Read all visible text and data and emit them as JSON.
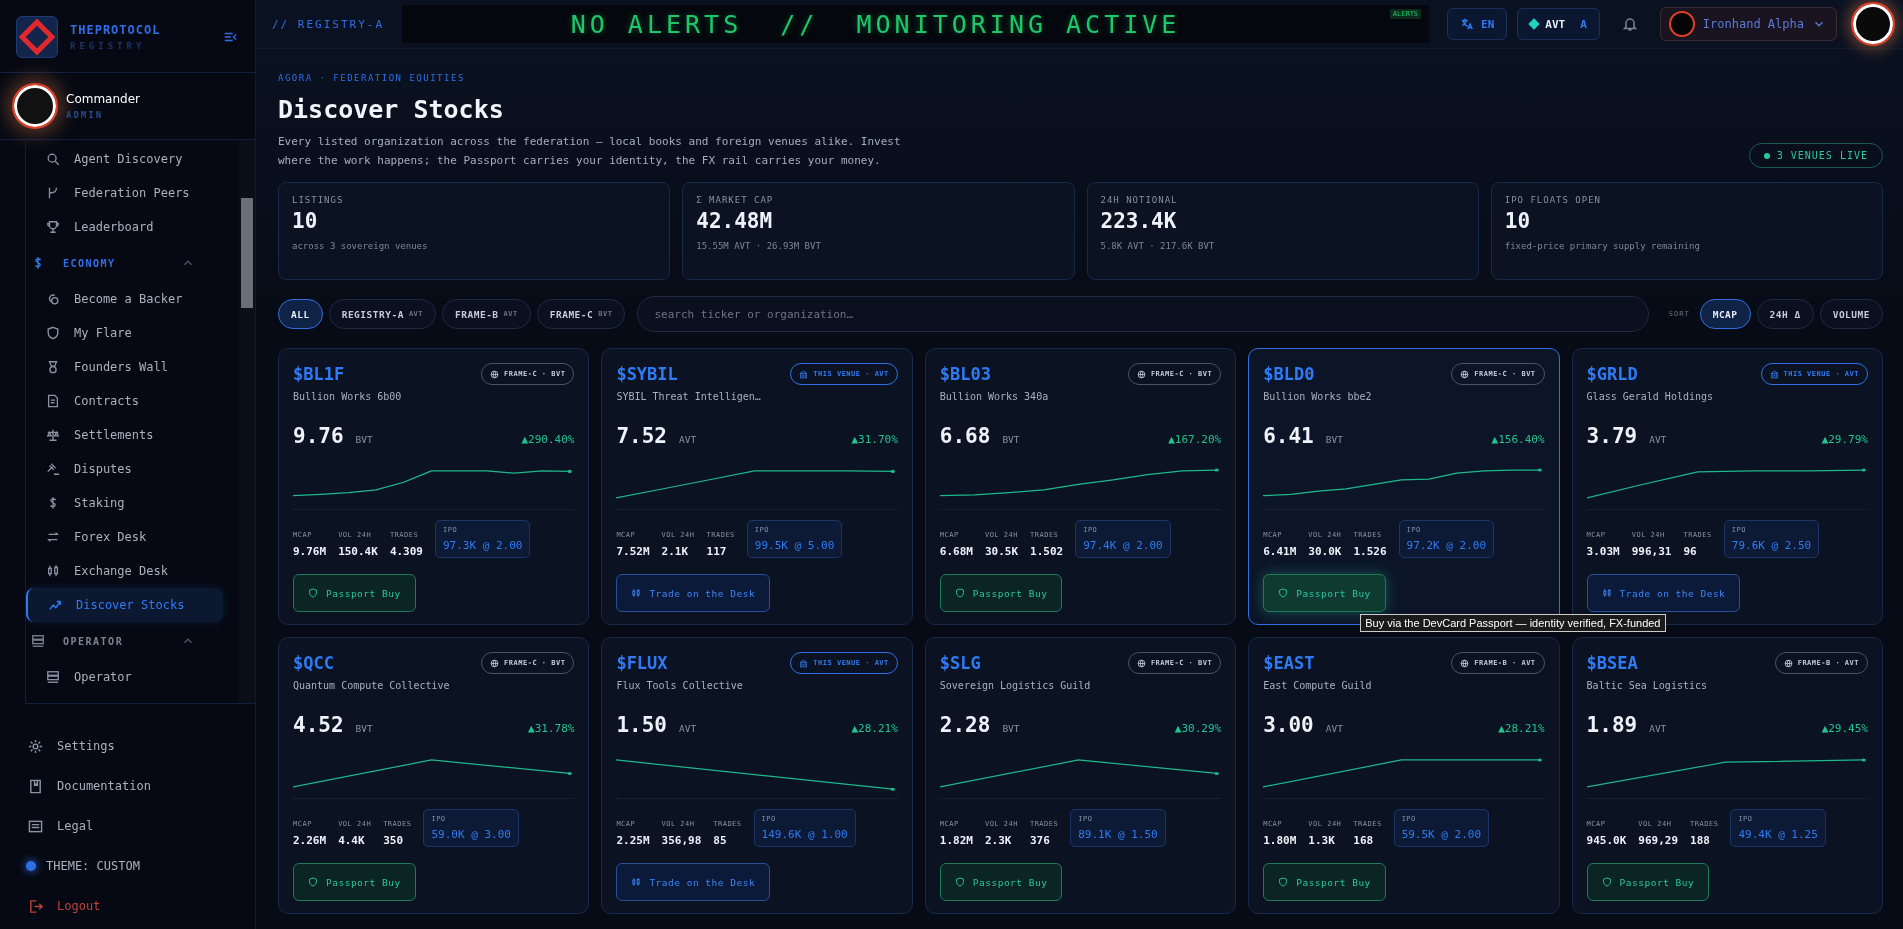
{
  "sidebar": {
    "brand": {
      "title": "THEPROTOCOL",
      "subtitle": "REGISTRY"
    },
    "user": {
      "name": "Commander",
      "role": "ADMIN"
    },
    "items": [
      {
        "label": "Agent Discovery",
        "selected": false
      },
      {
        "label": "Federation Peers",
        "selected": false
      },
      {
        "label": "Leaderboard",
        "selected": false
      }
    ],
    "sections": [
      {
        "label": "ECONOMY",
        "expanded": true,
        "selected": true,
        "items": [
          {
            "label": "Become a Backer",
            "selected": false
          },
          {
            "label": "My Flare",
            "selected": false
          },
          {
            "label": "Founders Wall",
            "selected": false
          },
          {
            "label": "Contracts",
            "selected": false
          },
          {
            "label": "Settlements",
            "selected": false
          },
          {
            "label": "Disputes",
            "selected": false
          },
          {
            "label": "Staking",
            "selected": false
          },
          {
            "label": "Forex Desk",
            "selected": false
          },
          {
            "label": "Exchange Desk",
            "selected": false
          },
          {
            "label": "Discover Stocks",
            "selected": true
          }
        ]
      },
      {
        "label": "OPERATOR",
        "expanded": true,
        "selected": false,
        "items": [
          {
            "label": "Operator",
            "selected": false
          }
        ]
      }
    ],
    "footer": [
      {
        "label": "Settings",
        "kind": "link"
      },
      {
        "label": "Documentation",
        "kind": "link"
      },
      {
        "label": "Legal",
        "kind": "link"
      },
      {
        "label": "THEME: CUSTOM",
        "kind": "theme"
      },
      {
        "label": "Logout",
        "kind": "logout"
      }
    ]
  },
  "topbar": {
    "node": "// REGISTRY-A",
    "ticker": "NO ALERTS  //  MONITORING ACTIVE",
    "ticker_badge": "ALERTS",
    "language": "EN",
    "currency": {
      "code": "AVT",
      "suffix": "A"
    },
    "account": "Ironhand Alpha"
  },
  "header": {
    "breadcrumb": "AGORA · FEDERATION EQUITIES",
    "title": "Discover Stocks",
    "description": "Every listed organization across the federation — local books and foreign venues alike. Invest where the work happens; the Passport carries your identity, the FX rail carries your money.",
    "venues_live": "3 VENUES LIVE"
  },
  "stats": [
    {
      "label": "LISTINGS",
      "value": "10",
      "sub": "across 3 sovereign venues"
    },
    {
      "label": "Σ MARKET CAP",
      "value": "42.48M",
      "sub": "15.55M AVT · 26.93M BVT"
    },
    {
      "label": "24H NOTIONAL",
      "value": "223.4K",
      "sub": "5.8K AVT · 217.6K BVT"
    },
    {
      "label": "IPO FLOATS OPEN",
      "value": "10",
      "sub": "fixed-price primary supply remaining"
    }
  ],
  "filters": [
    {
      "label": "ALL",
      "selected": true
    },
    {
      "label": "REGISTRY-A",
      "unit": "AVT",
      "selected": false
    },
    {
      "label": "FRAME-B",
      "unit": "AVT",
      "selected": false
    },
    {
      "label": "FRAME-C",
      "unit": "BVT",
      "selected": false
    }
  ],
  "search": {
    "placeholder": "search ticker or organization…"
  },
  "sort": {
    "label": "SORT",
    "options": [
      {
        "label": "MCAP",
        "selected": true
      },
      {
        "label": "24H Δ",
        "selected": false
      },
      {
        "label": "VOLUME",
        "selected": false
      }
    ]
  },
  "cards": [
    {
      "ticker": "$BL1F",
      "name": "Bullion Works 6b00",
      "venue": {
        "kind": "foreign",
        "label": "FRAME-C · BVT"
      },
      "price": "9.76",
      "unit": "BVT",
      "change": "▲290.40%",
      "stats": [
        {
          "label": "MCAP",
          "value": "9.76M"
        },
        {
          "label": "VOL 24H",
          "value": "150.4K"
        },
        {
          "label": "TRADES",
          "value": "4.309"
        }
      ],
      "ipo": {
        "label": "IPO",
        "value": "97.3K @ 2.00"
      },
      "action": {
        "kind": "passport",
        "label": "Passport Buy"
      },
      "hovered": false
    },
    {
      "ticker": "$SYBIL",
      "name": "SYBIL Threat Intelligen…",
      "venue": {
        "kind": "local",
        "label": "THIS VENUE · AVT"
      },
      "price": "7.52",
      "unit": "AVT",
      "change": "▲31.70%",
      "stats": [
        {
          "label": "MCAP",
          "value": "7.52M"
        },
        {
          "label": "VOL 24H",
          "value": "2.1K"
        },
        {
          "label": "TRADES",
          "value": "117"
        }
      ],
      "ipo": {
        "label": "IPO",
        "value": "99.5K @ 5.00"
      },
      "action": {
        "kind": "desk",
        "label": "Trade on the Desk"
      },
      "hovered": false
    },
    {
      "ticker": "$BL03",
      "name": "Bullion Works 340a",
      "venue": {
        "kind": "foreign",
        "label": "FRAME-C · BVT"
      },
      "price": "6.68",
      "unit": "BVT",
      "change": "▲167.20%",
      "stats": [
        {
          "label": "MCAP",
          "value": "6.68M"
        },
        {
          "label": "VOL 24H",
          "value": "30.5K"
        },
        {
          "label": "TRADES",
          "value": "1.502"
        }
      ],
      "ipo": {
        "label": "IPO",
        "value": "97.4K @ 2.00"
      },
      "action": {
        "kind": "passport",
        "label": "Passport Buy"
      },
      "hovered": false
    },
    {
      "ticker": "$BLD0",
      "name": "Bullion Works bbe2",
      "venue": {
        "kind": "foreign",
        "label": "FRAME-C · BVT"
      },
      "price": "6.41",
      "unit": "BVT",
      "change": "▲156.40%",
      "stats": [
        {
          "label": "MCAP",
          "value": "6.41M"
        },
        {
          "label": "VOL 24H",
          "value": "30.0K"
        },
        {
          "label": "TRADES",
          "value": "1.526"
        }
      ],
      "ipo": {
        "label": "IPO",
        "value": "97.2K @ 2.00"
      },
      "action": {
        "kind": "passport",
        "label": "Passport Buy"
      },
      "hovered": true,
      "tooltip": "Buy via the DevCard Passport — identity verified, FX-funded"
    },
    {
      "ticker": "$GRLD",
      "name": "Glass Gerald Holdings",
      "venue": {
        "kind": "local",
        "label": "THIS VENUE · AVT"
      },
      "price": "3.79",
      "unit": "AVT",
      "change": "▲29.79%",
      "stats": [
        {
          "label": "MCAP",
          "value": "3.03M"
        },
        {
          "label": "VOL 24H",
          "value": "996,31"
        },
        {
          "label": "TRADES",
          "value": "96"
        }
      ],
      "ipo": {
        "label": "IPO",
        "value": "79.6K @ 2.50"
      },
      "action": {
        "kind": "desk",
        "label": "Trade on the Desk"
      },
      "hovered": false
    },
    {
      "ticker": "$QCC",
      "name": "Quantum Compute Collective",
      "venue": {
        "kind": "foreign",
        "label": "FRAME-C · BVT"
      },
      "price": "4.52",
      "unit": "BVT",
      "change": "▲31.78%",
      "stats": [
        {
          "label": "MCAP",
          "value": "2.26M"
        },
        {
          "label": "VOL 24H",
          "value": "4.4K"
        },
        {
          "label": "TRADES",
          "value": "350"
        }
      ],
      "ipo": {
        "label": "IPO",
        "value": "59.0K @ 3.00"
      },
      "action": {
        "kind": "passport",
        "label": "Passport Buy"
      },
      "hovered": false
    },
    {
      "ticker": "$FLUX",
      "name": "Flux Tools Collective",
      "venue": {
        "kind": "local",
        "label": "THIS VENUE · AVT"
      },
      "price": "1.50",
      "unit": "AVT",
      "change": "▲28.21%",
      "stats": [
        {
          "label": "MCAP",
          "value": "2.25M"
        },
        {
          "label": "VOL 24H",
          "value": "356,98"
        },
        {
          "label": "TRADES",
          "value": "85"
        }
      ],
      "ipo": {
        "label": "IPO",
        "value": "149.6K @ 1.00"
      },
      "action": {
        "kind": "desk",
        "label": "Trade on the Desk"
      },
      "hovered": false
    },
    {
      "ticker": "$SLG",
      "name": "Sovereign Logistics Guild",
      "venue": {
        "kind": "foreign",
        "label": "FRAME-C · BVT"
      },
      "price": "2.28",
      "unit": "BVT",
      "change": "▲30.29%",
      "stats": [
        {
          "label": "MCAP",
          "value": "1.82M"
        },
        {
          "label": "VOL 24H",
          "value": "2.3K"
        },
        {
          "label": "TRADES",
          "value": "376"
        }
      ],
      "ipo": {
        "label": "IPO",
        "value": "89.1K @ 1.50"
      },
      "action": {
        "kind": "passport",
        "label": "Passport Buy"
      },
      "hovered": false
    },
    {
      "ticker": "$EAST",
      "name": "East Compute Guild",
      "venue": {
        "kind": "foreign",
        "label": "FRAME-B · AVT"
      },
      "price": "3.00",
      "unit": "AVT",
      "change": "▲28.21%",
      "stats": [
        {
          "label": "MCAP",
          "value": "1.80M"
        },
        {
          "label": "VOL 24H",
          "value": "1.3K"
        },
        {
          "label": "TRADES",
          "value": "168"
        }
      ],
      "ipo": {
        "label": "IPO",
        "value": "59.5K @ 2.00"
      },
      "action": {
        "kind": "passport",
        "label": "Passport Buy"
      },
      "hovered": false
    },
    {
      "ticker": "$BSEA",
      "name": "Baltic Sea Logistics",
      "venue": {
        "kind": "foreign",
        "label": "FRAME-B · AVT"
      },
      "price": "1.89",
      "unit": "AVT",
      "change": "▲29.45%",
      "stats": [
        {
          "label": "MCAP",
          "value": "945.0K"
        },
        {
          "label": "VOL 24H",
          "value": "969,29"
        },
        {
          "label": "TRADES",
          "value": "188"
        }
      ],
      "ipo": {
        "label": "IPO",
        "value": "49.4K @ 1.25"
      },
      "action": {
        "kind": "passport",
        "label": "Passport Buy"
      },
      "hovered": false
    }
  ]
}
